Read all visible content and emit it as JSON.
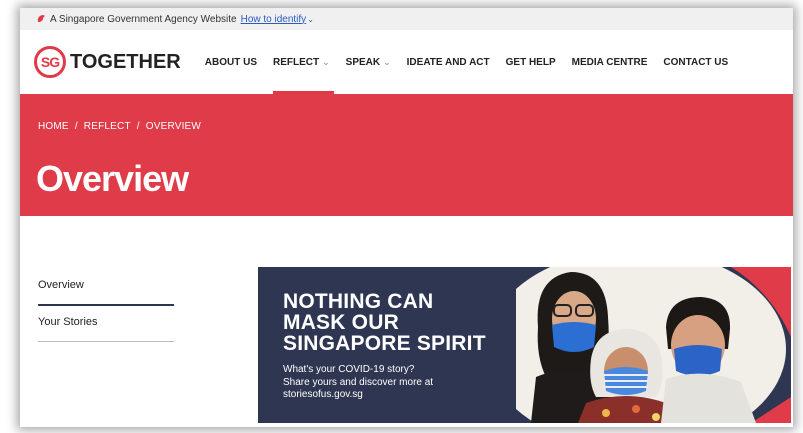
{
  "gov_bar": {
    "text": "A Singapore Government Agency Website",
    "link": "How to identify"
  },
  "logo": {
    "mark": "SG",
    "word": "TOGETHER"
  },
  "nav": [
    {
      "label": "ABOUT US",
      "has_dropdown": false
    },
    {
      "label": "REFLECT",
      "has_dropdown": true,
      "active": true
    },
    {
      "label": "SPEAK",
      "has_dropdown": true
    },
    {
      "label": "IDEATE AND ACT",
      "has_dropdown": false
    },
    {
      "label": "GET HELP",
      "has_dropdown": false
    },
    {
      "label": "MEDIA CENTRE",
      "has_dropdown": false
    },
    {
      "label": "CONTACT US",
      "has_dropdown": false
    }
  ],
  "breadcrumb": {
    "home": "HOME",
    "section": "REFLECT",
    "current": "OVERVIEW"
  },
  "page_title": "Overview",
  "sidebar": [
    {
      "label": "Overview",
      "active": true
    },
    {
      "label": "Your Stories",
      "active": false
    }
  ],
  "banner": {
    "line1": "NOTHING CAN",
    "line2": "MASK OUR",
    "line3": "SINGAPORE SPIRIT",
    "sub1": "What's your COVID-19 story?",
    "sub2": "Share yours and discover more at",
    "sub3": "storiesofus.gov.sg"
  },
  "colors": {
    "brand_red": "#df3b49",
    "banner_navy": "#2e3652",
    "link_blue": "#2b59c3"
  }
}
